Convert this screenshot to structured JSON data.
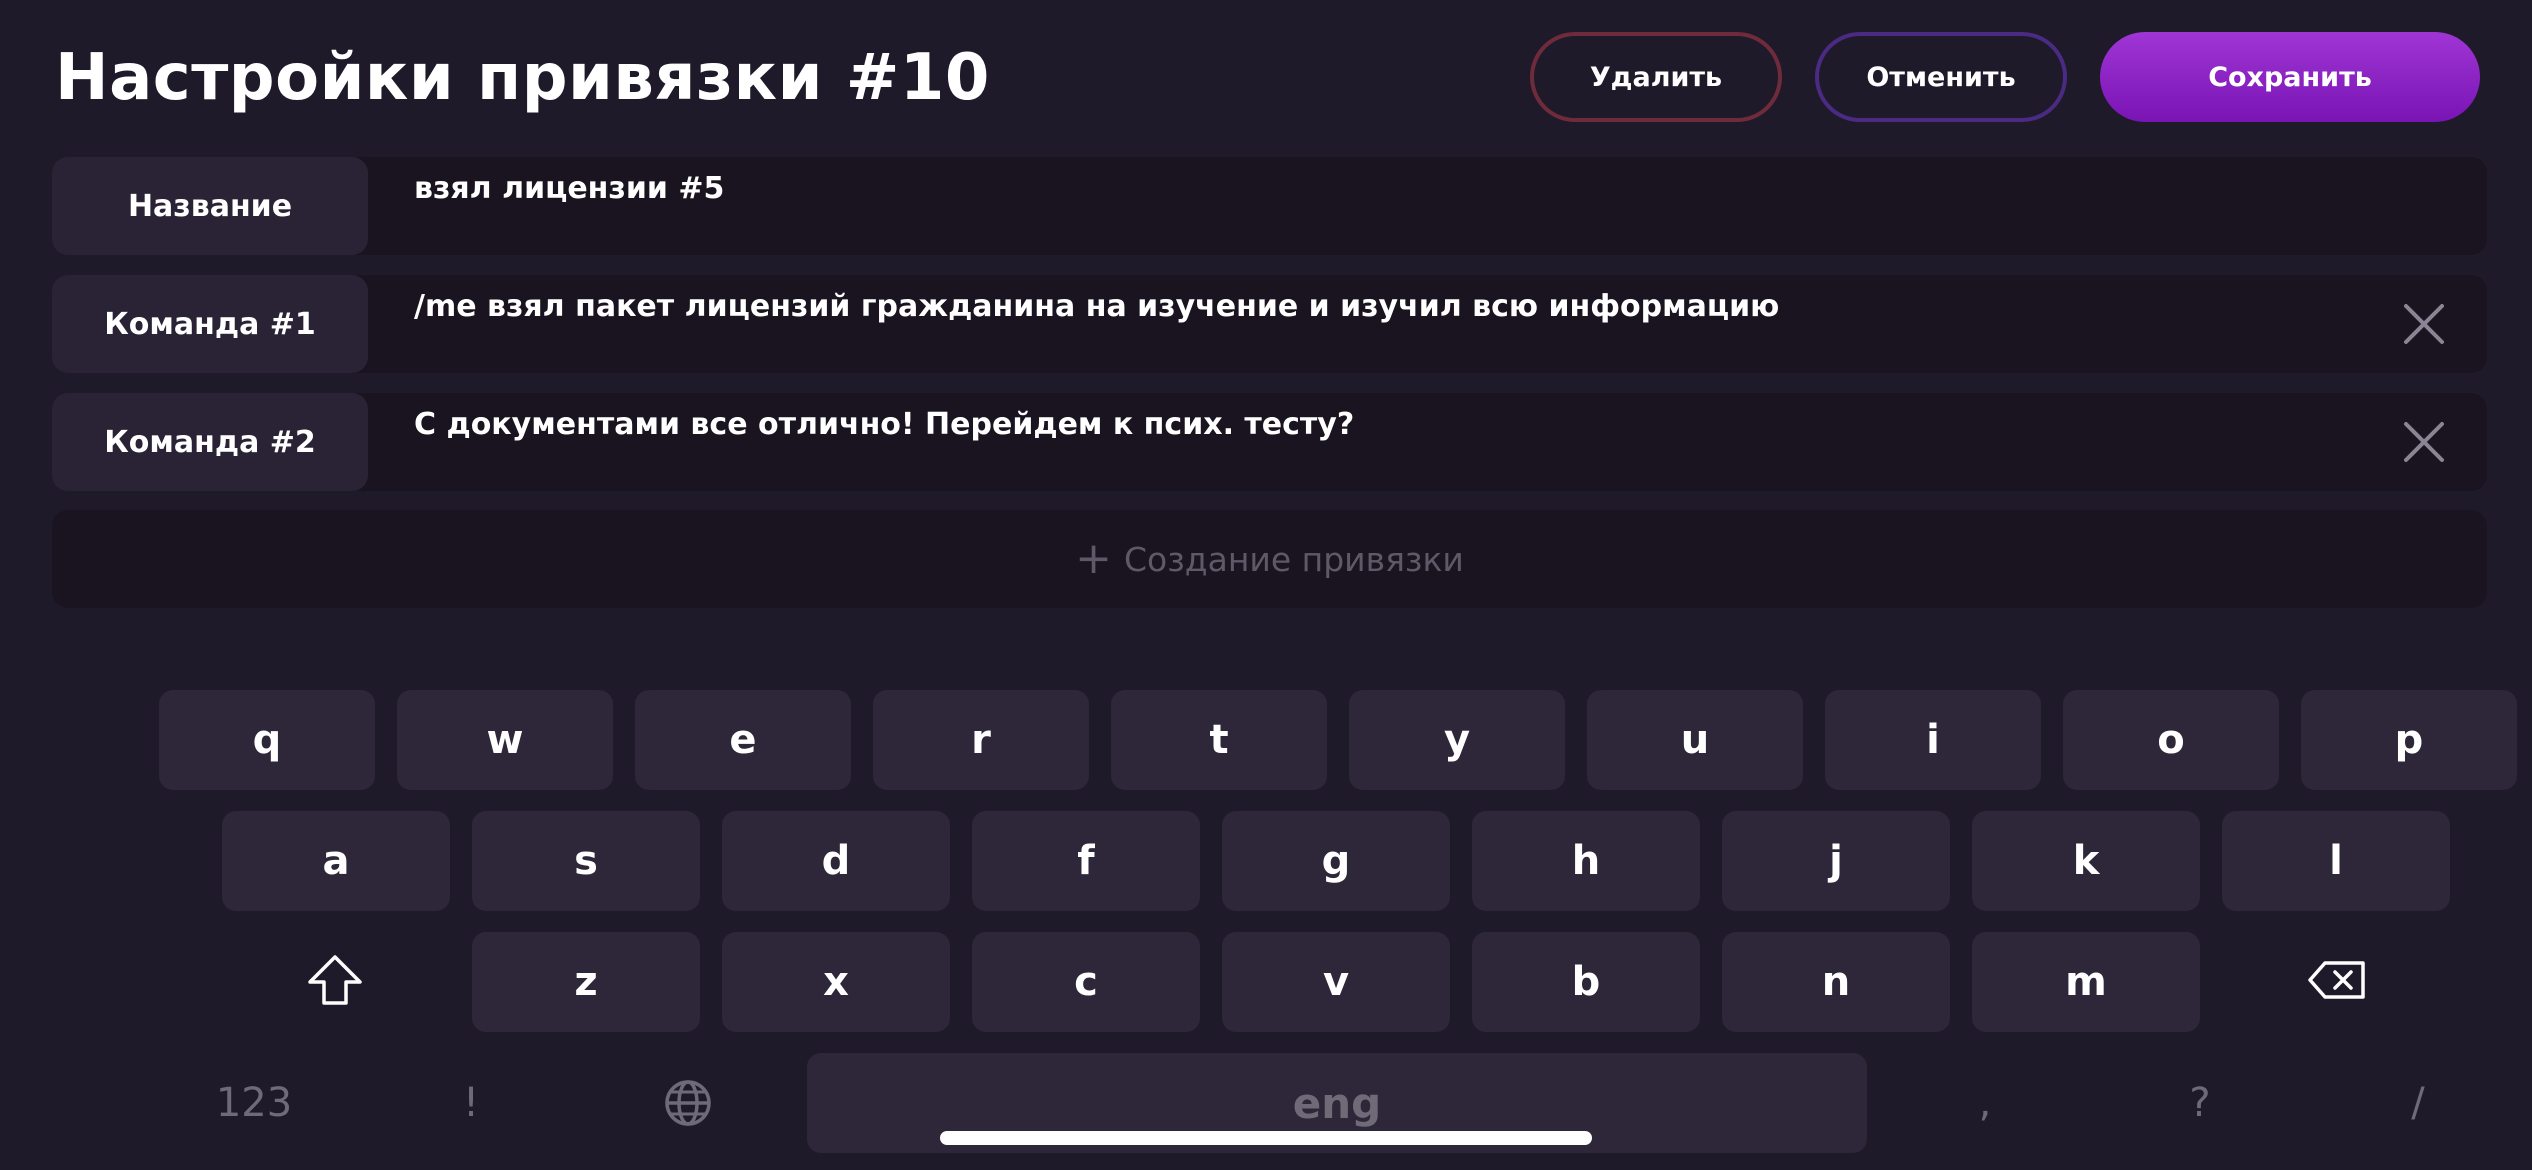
{
  "header": {
    "title": "Настройки привязки #10",
    "delete_label": "Удалить",
    "cancel_label": "Отменить",
    "save_label": "Сохранить"
  },
  "rows": [
    {
      "label": "Название",
      "value": "взял лицензии #5",
      "removable": false
    },
    {
      "label": "Команда #1",
      "value": "/me взял пакет лицензий гражданина на изучение и изучил всю информацию",
      "removable": true
    },
    {
      "label": "Команда #2",
      "value": "С документами все отлично! Перейдем к псих. тесту?",
      "removable": true
    }
  ],
  "create": {
    "icon": "plus-icon",
    "label": "Создание привязки"
  },
  "keyboard": {
    "row1": [
      "q",
      "w",
      "e",
      "r",
      "t",
      "y",
      "u",
      "i",
      "o",
      "p"
    ],
    "row2": [
      "a",
      "s",
      "d",
      "f",
      "g",
      "h",
      "j",
      "k",
      "l"
    ],
    "row3": [
      "z",
      "x",
      "c",
      "v",
      "b",
      "n",
      "m"
    ],
    "shift_icon": "shift-icon",
    "backspace_icon": "backspace-icon",
    "globe_icon": "globe-icon",
    "numbers_label": "123",
    "exclaim_label": "!",
    "space_label": "eng",
    "comma_label": ",",
    "question_label": "?",
    "slash_label": "/"
  },
  "colors": {
    "background": "#1f1a29",
    "delete_border": "#6e2b3c",
    "cancel_border": "#4b2a84",
    "save_accent": "#8e23c6"
  }
}
